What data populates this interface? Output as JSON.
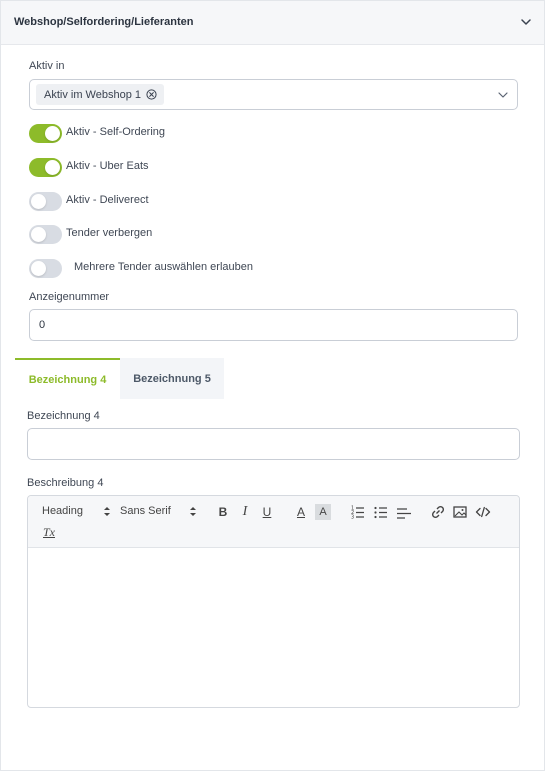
{
  "panel": {
    "title": "Webshop/Selfordering/Lieferanten",
    "collapse_icon": "chevron-down-icon"
  },
  "active_in": {
    "label": "Aktiv in",
    "selected_chip": "Aktiv im Webshop 1",
    "chip_remove_icon": "circle-x-icon",
    "caret_icon": "chevron-down-icon"
  },
  "toggles": [
    {
      "label": "Aktiv - Self-Ordering",
      "on": true
    },
    {
      "label": "Aktiv - Uber Eats",
      "on": true
    },
    {
      "label": "Aktiv - Deliverect",
      "on": false
    },
    {
      "label": "Tender verbergen",
      "on": false
    },
    {
      "label": "Mehrere Tender auswählen erlauben",
      "on": false
    }
  ],
  "display_number": {
    "label": "Anzeigenummer",
    "value": "0"
  },
  "tabs": [
    {
      "label": "Bezeichnung 4",
      "active": true
    },
    {
      "label": "Bezeichnung 5",
      "active": false
    }
  ],
  "designation": {
    "label": "Bezeichnung 4",
    "value": ""
  },
  "description": {
    "label": "Beschreibung 4",
    "toolbar": {
      "heading_picker": "Heading",
      "font_picker": "Sans Serif",
      "bold": "B",
      "italic": "I",
      "underline": "U",
      "font_color": "A",
      "background_color": "A",
      "clear_format": "Tx"
    }
  },
  "colors": {
    "accent": "#8dbb2a",
    "toggle_off": "#d8dce3",
    "header_bg": "#f6f7f9"
  }
}
